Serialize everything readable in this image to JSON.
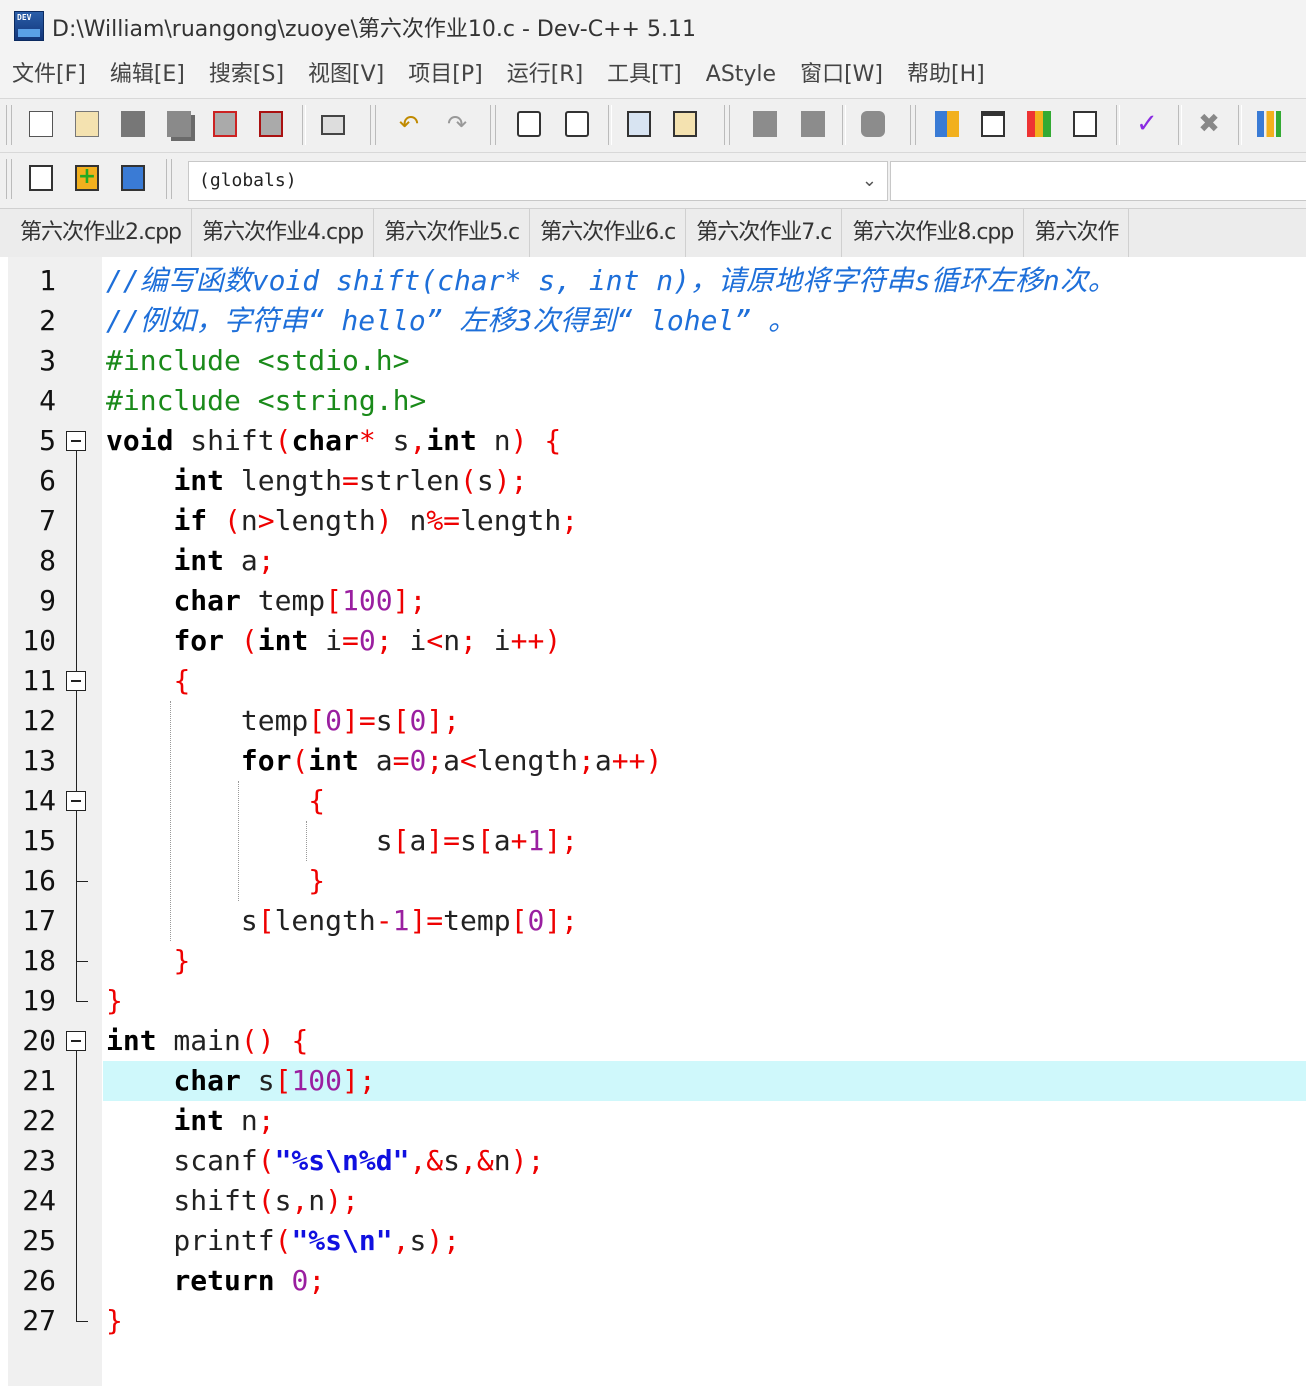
{
  "window": {
    "title": "D:\\William\\ruangong\\zuoye\\第六次作业10.c - Dev-C++ 5.11",
    "icon_text": "DEV"
  },
  "menu": [
    "文件[F]",
    "编辑[E]",
    "搜索[S]",
    "视图[V]",
    "项目[P]",
    "运行[R]",
    "工具[T]",
    "AStyle",
    "窗口[W]",
    "帮助[H]"
  ],
  "toolbar2": {
    "scope_value": "(globals)"
  },
  "tabs": [
    "第六次作业2.cpp",
    "第六次作业4.cpp",
    "第六次作业5.c",
    "第六次作业6.c",
    "第六次作业7.c",
    "第六次作业8.cpp",
    "第六次作"
  ],
  "editor": {
    "highlighted_line": 21,
    "lines": [
      [
        [
          "cmt",
          "//编写函数void shift(char* s, int n)，请原地将字符串s循环左移n次。"
        ]
      ],
      [
        [
          "cmt",
          "//例如，字符串“ hello” 左移3次得到“ lohel” 。"
        ]
      ],
      [
        [
          "pp",
          "#include <stdio.h>"
        ]
      ],
      [
        [
          "pp",
          "#include <string.h>"
        ]
      ],
      [
        [
          "kw",
          "void"
        ],
        [
          "id",
          " shift"
        ],
        [
          "sym",
          "("
        ],
        [
          "kw",
          "char"
        ],
        [
          "sym",
          "*"
        ],
        [
          "id",
          " s"
        ],
        [
          "sym",
          ","
        ],
        [
          "kw",
          "int"
        ],
        [
          "id",
          " n"
        ],
        [
          "sym",
          ")"
        ],
        [
          "id",
          " "
        ],
        [
          "sym",
          "{"
        ]
      ],
      [
        [
          "id",
          "    "
        ],
        [
          "kw",
          "int"
        ],
        [
          "id",
          " length"
        ],
        [
          "sym",
          "="
        ],
        [
          "id",
          "strlen"
        ],
        [
          "sym",
          "("
        ],
        [
          "id",
          "s"
        ],
        [
          "sym",
          ");"
        ]
      ],
      [
        [
          "id",
          "    "
        ],
        [
          "kw",
          "if"
        ],
        [
          "id",
          " "
        ],
        [
          "sym",
          "("
        ],
        [
          "id",
          "n"
        ],
        [
          "sym",
          ">"
        ],
        [
          "id",
          "length"
        ],
        [
          "sym",
          ")"
        ],
        [
          "id",
          " n"
        ],
        [
          "sym",
          "%="
        ],
        [
          "id",
          "length"
        ],
        [
          "sym",
          ";"
        ]
      ],
      [
        [
          "id",
          "    "
        ],
        [
          "kw",
          "int"
        ],
        [
          "id",
          " a"
        ],
        [
          "sym",
          ";"
        ]
      ],
      [
        [
          "id",
          "    "
        ],
        [
          "kw",
          "char"
        ],
        [
          "id",
          " temp"
        ],
        [
          "sym",
          "["
        ],
        [
          "num",
          "100"
        ],
        [
          "sym",
          "];"
        ]
      ],
      [
        [
          "id",
          "    "
        ],
        [
          "kw",
          "for"
        ],
        [
          "id",
          " "
        ],
        [
          "sym",
          "("
        ],
        [
          "kw",
          "int"
        ],
        [
          "id",
          " i"
        ],
        [
          "sym",
          "="
        ],
        [
          "num",
          "0"
        ],
        [
          "sym",
          ";"
        ],
        [
          "id",
          " i"
        ],
        [
          "sym",
          "<"
        ],
        [
          "id",
          "n"
        ],
        [
          "sym",
          ";"
        ],
        [
          "id",
          " i"
        ],
        [
          "sym",
          "++)"
        ]
      ],
      [
        [
          "id",
          "    "
        ],
        [
          "sym",
          "{"
        ]
      ],
      [
        [
          "id",
          "        temp"
        ],
        [
          "sym",
          "["
        ],
        [
          "num",
          "0"
        ],
        [
          "sym",
          "]="
        ],
        [
          "id",
          "s"
        ],
        [
          "sym",
          "["
        ],
        [
          "num",
          "0"
        ],
        [
          "sym",
          "];"
        ]
      ],
      [
        [
          "id",
          "        "
        ],
        [
          "kw",
          "for"
        ],
        [
          "sym",
          "("
        ],
        [
          "kw",
          "int"
        ],
        [
          "id",
          " a"
        ],
        [
          "sym",
          "="
        ],
        [
          "num",
          "0"
        ],
        [
          "sym",
          ";"
        ],
        [
          "id",
          "a"
        ],
        [
          "sym",
          "<"
        ],
        [
          "id",
          "length"
        ],
        [
          "sym",
          ";"
        ],
        [
          "id",
          "a"
        ],
        [
          "sym",
          "++)"
        ]
      ],
      [
        [
          "id",
          "            "
        ],
        [
          "sym",
          "{"
        ]
      ],
      [
        [
          "id",
          "                s"
        ],
        [
          "sym",
          "["
        ],
        [
          "id",
          "a"
        ],
        [
          "sym",
          "]="
        ],
        [
          "id",
          "s"
        ],
        [
          "sym",
          "["
        ],
        [
          "id",
          "a"
        ],
        [
          "sym",
          "+"
        ],
        [
          "num",
          "1"
        ],
        [
          "sym",
          "];"
        ]
      ],
      [
        [
          "id",
          "            "
        ],
        [
          "sym",
          "}"
        ]
      ],
      [
        [
          "id",
          "        s"
        ],
        [
          "sym",
          "["
        ],
        [
          "id",
          "length"
        ],
        [
          "sym",
          "-"
        ],
        [
          "num",
          "1"
        ],
        [
          "sym",
          "]="
        ],
        [
          "id",
          "temp"
        ],
        [
          "sym",
          "["
        ],
        [
          "num",
          "0"
        ],
        [
          "sym",
          "];"
        ]
      ],
      [
        [
          "id",
          "    "
        ],
        [
          "sym",
          "}"
        ]
      ],
      [
        [
          "sym",
          "}"
        ]
      ],
      [
        [
          "kw",
          "int"
        ],
        [
          "id",
          " main"
        ],
        [
          "sym",
          "()"
        ],
        [
          "id",
          " "
        ],
        [
          "sym",
          "{"
        ]
      ],
      [
        [
          "id",
          "    "
        ],
        [
          "kw",
          "char"
        ],
        [
          "id",
          " s"
        ],
        [
          "sym",
          "["
        ],
        [
          "num",
          "100"
        ],
        [
          "sym",
          "];"
        ]
      ],
      [
        [
          "id",
          "    "
        ],
        [
          "kw",
          "int"
        ],
        [
          "id",
          " n"
        ],
        [
          "sym",
          ";"
        ]
      ],
      [
        [
          "id",
          "    scanf"
        ],
        [
          "sym",
          "("
        ],
        [
          "str",
          "\"%s\\n%d\""
        ],
        [
          "sym",
          ",&"
        ],
        [
          "id",
          "s"
        ],
        [
          "sym",
          ",&"
        ],
        [
          "id",
          "n"
        ],
        [
          "sym",
          ");"
        ]
      ],
      [
        [
          "id",
          "    shift"
        ],
        [
          "sym",
          "("
        ],
        [
          "id",
          "s"
        ],
        [
          "sym",
          ","
        ],
        [
          "id",
          "n"
        ],
        [
          "sym",
          ");"
        ]
      ],
      [
        [
          "id",
          "    printf"
        ],
        [
          "sym",
          "("
        ],
        [
          "str",
          "\"%s\\n\""
        ],
        [
          "sym",
          ","
        ],
        [
          "id",
          "s"
        ],
        [
          "sym",
          ");"
        ]
      ],
      [
        [
          "id",
          "    "
        ],
        [
          "kw",
          "return"
        ],
        [
          "id",
          " "
        ],
        [
          "num",
          "0"
        ],
        [
          "sym",
          ";"
        ]
      ],
      [
        [
          "sym",
          "}"
        ]
      ]
    ]
  }
}
